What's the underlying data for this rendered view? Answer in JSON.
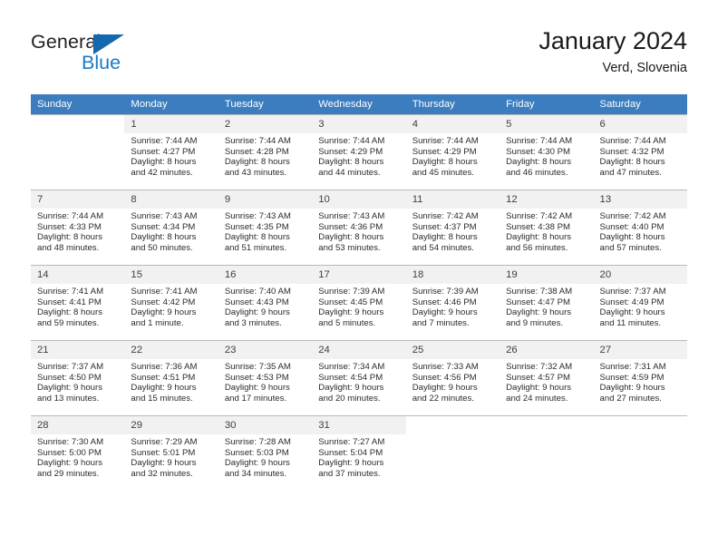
{
  "brand": {
    "name_part1": "General",
    "name_part2": "Blue",
    "triangle_icon": "triangle-icon",
    "colors": {
      "dark": "#231f20",
      "blue": "#1b7ac4",
      "triangle": "#1567ae"
    }
  },
  "header": {
    "title": "January 2024",
    "subtitle": "Verd, Slovenia"
  },
  "theme": {
    "header_row_bg": "#3b7dbf",
    "daynum_bg": "#f1f1f1",
    "grid_line": "#b9b9b9"
  },
  "calendar": {
    "weekday_headers": [
      "Sunday",
      "Monday",
      "Tuesday",
      "Wednesday",
      "Thursday",
      "Friday",
      "Saturday"
    ],
    "weeks": [
      [
        {
          "day": "",
          "sunrise": "",
          "sunset": "",
          "daylight_line1": "",
          "daylight_line2": ""
        },
        {
          "day": "1",
          "sunrise": "Sunrise: 7:44 AM",
          "sunset": "Sunset: 4:27 PM",
          "daylight_line1": "Daylight: 8 hours",
          "daylight_line2": "and 42 minutes."
        },
        {
          "day": "2",
          "sunrise": "Sunrise: 7:44 AM",
          "sunset": "Sunset: 4:28 PM",
          "daylight_line1": "Daylight: 8 hours",
          "daylight_line2": "and 43 minutes."
        },
        {
          "day": "3",
          "sunrise": "Sunrise: 7:44 AM",
          "sunset": "Sunset: 4:29 PM",
          "daylight_line1": "Daylight: 8 hours",
          "daylight_line2": "and 44 minutes."
        },
        {
          "day": "4",
          "sunrise": "Sunrise: 7:44 AM",
          "sunset": "Sunset: 4:29 PM",
          "daylight_line1": "Daylight: 8 hours",
          "daylight_line2": "and 45 minutes."
        },
        {
          "day": "5",
          "sunrise": "Sunrise: 7:44 AM",
          "sunset": "Sunset: 4:30 PM",
          "daylight_line1": "Daylight: 8 hours",
          "daylight_line2": "and 46 minutes."
        },
        {
          "day": "6",
          "sunrise": "Sunrise: 7:44 AM",
          "sunset": "Sunset: 4:32 PM",
          "daylight_line1": "Daylight: 8 hours",
          "daylight_line2": "and 47 minutes."
        }
      ],
      [
        {
          "day": "7",
          "sunrise": "Sunrise: 7:44 AM",
          "sunset": "Sunset: 4:33 PM",
          "daylight_line1": "Daylight: 8 hours",
          "daylight_line2": "and 48 minutes."
        },
        {
          "day": "8",
          "sunrise": "Sunrise: 7:43 AM",
          "sunset": "Sunset: 4:34 PM",
          "daylight_line1": "Daylight: 8 hours",
          "daylight_line2": "and 50 minutes."
        },
        {
          "day": "9",
          "sunrise": "Sunrise: 7:43 AM",
          "sunset": "Sunset: 4:35 PM",
          "daylight_line1": "Daylight: 8 hours",
          "daylight_line2": "and 51 minutes."
        },
        {
          "day": "10",
          "sunrise": "Sunrise: 7:43 AM",
          "sunset": "Sunset: 4:36 PM",
          "daylight_line1": "Daylight: 8 hours",
          "daylight_line2": "and 53 minutes."
        },
        {
          "day": "11",
          "sunrise": "Sunrise: 7:42 AM",
          "sunset": "Sunset: 4:37 PM",
          "daylight_line1": "Daylight: 8 hours",
          "daylight_line2": "and 54 minutes."
        },
        {
          "day": "12",
          "sunrise": "Sunrise: 7:42 AM",
          "sunset": "Sunset: 4:38 PM",
          "daylight_line1": "Daylight: 8 hours",
          "daylight_line2": "and 56 minutes."
        },
        {
          "day": "13",
          "sunrise": "Sunrise: 7:42 AM",
          "sunset": "Sunset: 4:40 PM",
          "daylight_line1": "Daylight: 8 hours",
          "daylight_line2": "and 57 minutes."
        }
      ],
      [
        {
          "day": "14",
          "sunrise": "Sunrise: 7:41 AM",
          "sunset": "Sunset: 4:41 PM",
          "daylight_line1": "Daylight: 8 hours",
          "daylight_line2": "and 59 minutes."
        },
        {
          "day": "15",
          "sunrise": "Sunrise: 7:41 AM",
          "sunset": "Sunset: 4:42 PM",
          "daylight_line1": "Daylight: 9 hours",
          "daylight_line2": "and 1 minute."
        },
        {
          "day": "16",
          "sunrise": "Sunrise: 7:40 AM",
          "sunset": "Sunset: 4:43 PM",
          "daylight_line1": "Daylight: 9 hours",
          "daylight_line2": "and 3 minutes."
        },
        {
          "day": "17",
          "sunrise": "Sunrise: 7:39 AM",
          "sunset": "Sunset: 4:45 PM",
          "daylight_line1": "Daylight: 9 hours",
          "daylight_line2": "and 5 minutes."
        },
        {
          "day": "18",
          "sunrise": "Sunrise: 7:39 AM",
          "sunset": "Sunset: 4:46 PM",
          "daylight_line1": "Daylight: 9 hours",
          "daylight_line2": "and 7 minutes."
        },
        {
          "day": "19",
          "sunrise": "Sunrise: 7:38 AM",
          "sunset": "Sunset: 4:47 PM",
          "daylight_line1": "Daylight: 9 hours",
          "daylight_line2": "and 9 minutes."
        },
        {
          "day": "20",
          "sunrise": "Sunrise: 7:37 AM",
          "sunset": "Sunset: 4:49 PM",
          "daylight_line1": "Daylight: 9 hours",
          "daylight_line2": "and 11 minutes."
        }
      ],
      [
        {
          "day": "21",
          "sunrise": "Sunrise: 7:37 AM",
          "sunset": "Sunset: 4:50 PM",
          "daylight_line1": "Daylight: 9 hours",
          "daylight_line2": "and 13 minutes."
        },
        {
          "day": "22",
          "sunrise": "Sunrise: 7:36 AM",
          "sunset": "Sunset: 4:51 PM",
          "daylight_line1": "Daylight: 9 hours",
          "daylight_line2": "and 15 minutes."
        },
        {
          "day": "23",
          "sunrise": "Sunrise: 7:35 AM",
          "sunset": "Sunset: 4:53 PM",
          "daylight_line1": "Daylight: 9 hours",
          "daylight_line2": "and 17 minutes."
        },
        {
          "day": "24",
          "sunrise": "Sunrise: 7:34 AM",
          "sunset": "Sunset: 4:54 PM",
          "daylight_line1": "Daylight: 9 hours",
          "daylight_line2": "and 20 minutes."
        },
        {
          "day": "25",
          "sunrise": "Sunrise: 7:33 AM",
          "sunset": "Sunset: 4:56 PM",
          "daylight_line1": "Daylight: 9 hours",
          "daylight_line2": "and 22 minutes."
        },
        {
          "day": "26",
          "sunrise": "Sunrise: 7:32 AM",
          "sunset": "Sunset: 4:57 PM",
          "daylight_line1": "Daylight: 9 hours",
          "daylight_line2": "and 24 minutes."
        },
        {
          "day": "27",
          "sunrise": "Sunrise: 7:31 AM",
          "sunset": "Sunset: 4:59 PM",
          "daylight_line1": "Daylight: 9 hours",
          "daylight_line2": "and 27 minutes."
        }
      ],
      [
        {
          "day": "28",
          "sunrise": "Sunrise: 7:30 AM",
          "sunset": "Sunset: 5:00 PM",
          "daylight_line1": "Daylight: 9 hours",
          "daylight_line2": "and 29 minutes."
        },
        {
          "day": "29",
          "sunrise": "Sunrise: 7:29 AM",
          "sunset": "Sunset: 5:01 PM",
          "daylight_line1": "Daylight: 9 hours",
          "daylight_line2": "and 32 minutes."
        },
        {
          "day": "30",
          "sunrise": "Sunrise: 7:28 AM",
          "sunset": "Sunset: 5:03 PM",
          "daylight_line1": "Daylight: 9 hours",
          "daylight_line2": "and 34 minutes."
        },
        {
          "day": "31",
          "sunrise": "Sunrise: 7:27 AM",
          "sunset": "Sunset: 5:04 PM",
          "daylight_line1": "Daylight: 9 hours",
          "daylight_line2": "and 37 minutes."
        },
        {
          "day": "",
          "sunrise": "",
          "sunset": "",
          "daylight_line1": "",
          "daylight_line2": ""
        },
        {
          "day": "",
          "sunrise": "",
          "sunset": "",
          "daylight_line1": "",
          "daylight_line2": ""
        },
        {
          "day": "",
          "sunrise": "",
          "sunset": "",
          "daylight_line1": "",
          "daylight_line2": ""
        }
      ]
    ]
  }
}
